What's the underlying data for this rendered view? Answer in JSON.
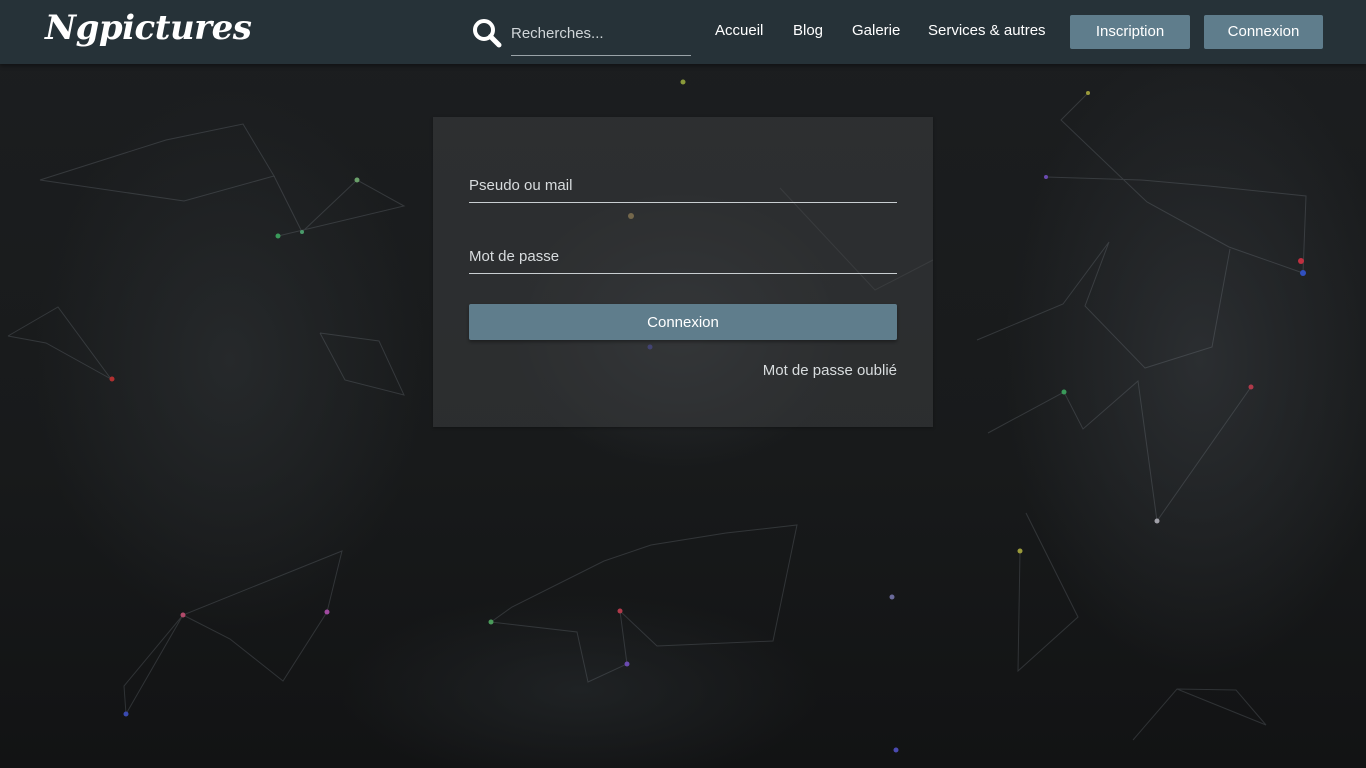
{
  "header": {
    "logo": "Ngpictures",
    "search_placeholder": "Recherches...",
    "nav": [
      "Accueil",
      "Blog",
      "Galerie",
      "Services & autres"
    ],
    "signup_label": "Inscription",
    "login_label": "Connexion"
  },
  "login": {
    "username_placeholder": "Pseudo ou mail",
    "password_placeholder": "Mot de passe",
    "submit_label": "Connexion",
    "forgot_label": "Mot de passe oublié"
  },
  "colors": {
    "topbar": "#263238",
    "button": "#5f7d8c"
  },
  "icons": {
    "search": "search-icon"
  }
}
